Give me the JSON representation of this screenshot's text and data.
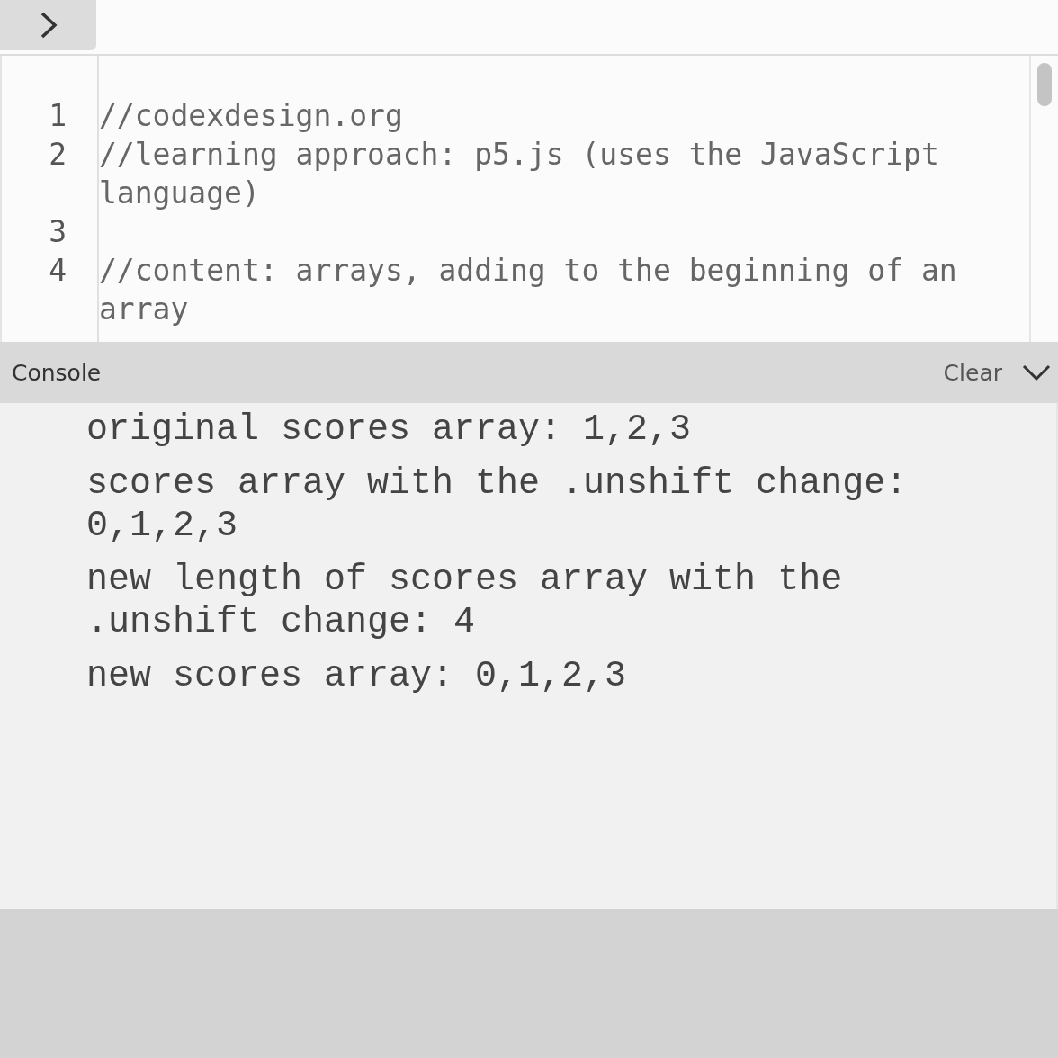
{
  "editor": {
    "lines": [
      {
        "number": "1",
        "text": "//codexdesign.org"
      },
      {
        "number": "2",
        "text": "//learning approach: p5.js (uses the JavaScript language)"
      },
      {
        "number": "3"
      },
      {
        "number": "4",
        "text": "//content: arrays, adding to the beginning of an array"
      }
    ]
  },
  "console": {
    "title": "Console",
    "clear_label": "Clear",
    "expanded": true,
    "messages": [
      "original scores array: 1,2,3",
      "scores array with the .unshift change: 0,1,2,3",
      "new length of scores array with the .unshift change: 4",
      "new scores array: 0,1,2,3"
    ]
  }
}
